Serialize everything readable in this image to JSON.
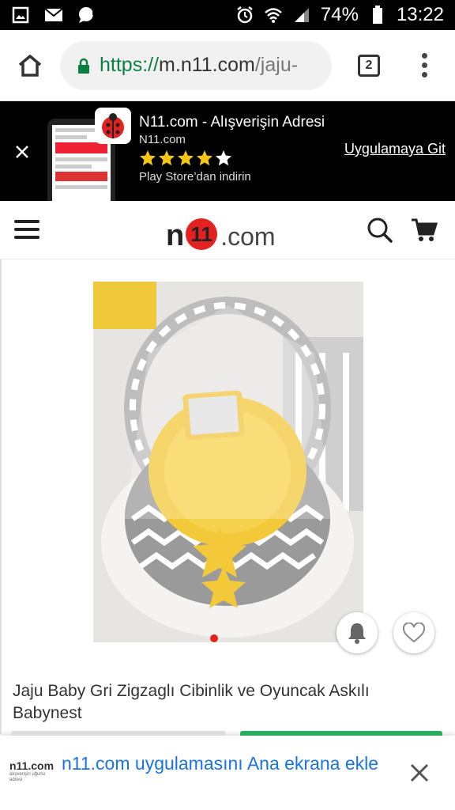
{
  "status_bar": {
    "battery_percent": "74%",
    "time": "13:22"
  },
  "browser": {
    "url_scheme": "https://",
    "url_host": "m.n11.com",
    "url_path": "/jaju-",
    "tab_count": "2"
  },
  "app_banner": {
    "title": "N11.com - Alışverişin Adresi",
    "subtitle": "N11.com",
    "rating_stars": 4.5,
    "store_text": "Play Store’dan indirin",
    "cta": "Uygulamaya Git"
  },
  "header": {
    "brand_n": "n",
    "brand_11": "11",
    "brand_dotcom": ".com"
  },
  "product": {
    "title": "Jaju Baby Gri Zigzaglı Cibinlik ve Oyuncak Askılı Babynest"
  },
  "add_to_home": {
    "logo_main": "n11.com",
    "logo_sub": "alışverişin uğurlu adresi",
    "text": "n11.com uygulamasını Ana ekrana ekle"
  },
  "colors": {
    "brand_red": "#e32121",
    "url_green": "#0b8043",
    "link_blue": "#1a73e8",
    "buy_green": "#27ae60"
  }
}
